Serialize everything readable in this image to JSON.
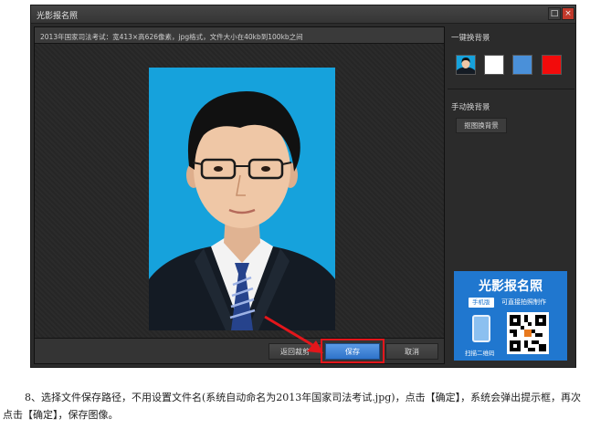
{
  "window": {
    "title": "光影报名照",
    "maximize_glyph": "□",
    "close_glyph": "×"
  },
  "photo_panel": {
    "spec_text": "2013年国家司法考试：宽413×高626像素，jpg格式，文件大小在40kb到100kb之间",
    "background_color": "#16a2dc"
  },
  "buttons": {
    "reset_crop": "返回裁剪",
    "save": "保存",
    "cancel": "取消"
  },
  "right_panel": {
    "one_click_title": "一键换背景",
    "swatches": [
      {
        "name": "current-photo",
        "color": "#16a2dc"
      },
      {
        "name": "white",
        "color": "#ffffff"
      },
      {
        "name": "blue",
        "color": "#4a90d9"
      },
      {
        "name": "red",
        "color": "#f20b0b"
      }
    ],
    "manual_title": "手动换背景",
    "cutout_button": "抠图换背景"
  },
  "promo": {
    "title": "光影报名照",
    "badge": "手机版",
    "subtitle": "可直接拍照制作",
    "scan_text": "扫描二维码"
  },
  "caption": "8、选择文件保存路径，不用设置文件名(系统自动命名为2013年国家司法考试.jpg)，点击【确定】，系统会弹出提示框，再次点击【确定】，保存图像。",
  "colors": {
    "accent_blue": "#2f73c9",
    "highlight_red": "#e3161b"
  }
}
